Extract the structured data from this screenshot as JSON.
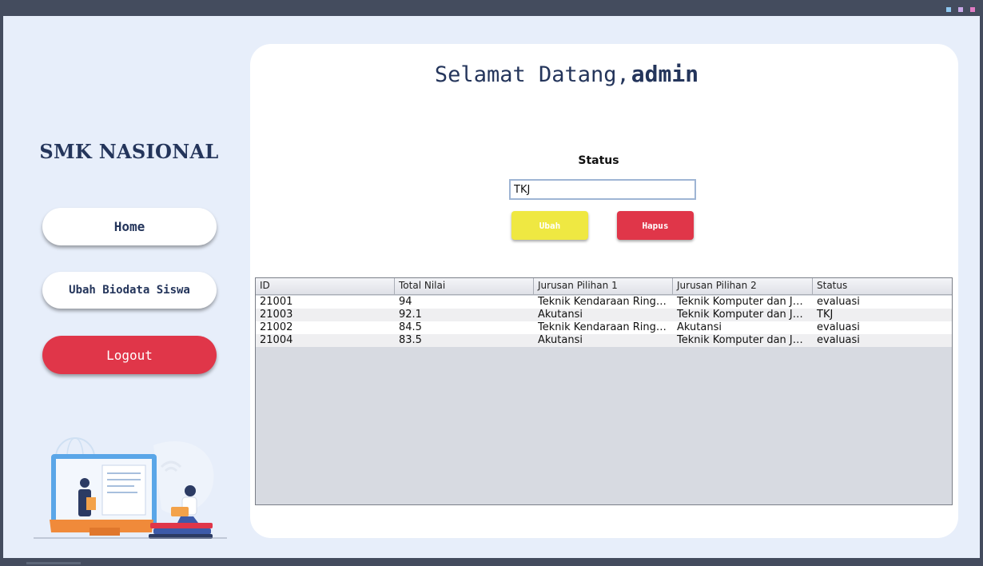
{
  "sidebar": {
    "brand": "SMK NASIONAL",
    "nav": {
      "home": "Home",
      "biodata": "Ubah Biodata Siswa",
      "logout": "Logout"
    }
  },
  "main": {
    "welcome_prefix": "Selamat Datang,",
    "username": "admin",
    "status_label": "Status",
    "status_value": "TKJ",
    "ubah_label": "Ubah",
    "hapus_label": "Hapus"
  },
  "table": {
    "columns": [
      "ID",
      "Total Nilai",
      "Jurusan Pilihan 1",
      "Jurusan Pilihan 2",
      "Status"
    ],
    "rows": [
      [
        "21001",
        "94",
        "Teknik Kendaraan Ringan",
        "Teknik Komputer dan Jar...",
        "evaluasi"
      ],
      [
        "21003",
        "92.1",
        "Akutansi",
        "Teknik Komputer dan Jar...",
        "TKJ"
      ],
      [
        "21002",
        "84.5",
        "Teknik Kendaraan Ringan",
        "Akutansi",
        "evaluasi"
      ],
      [
        "21004",
        "83.5",
        "Akutansi",
        "Teknik Komputer dan Jar...",
        "evaluasi"
      ]
    ]
  },
  "colors": {
    "navy": "#24355b",
    "red": "#e03649",
    "yellow": "#efe842",
    "background": "#e7eefa"
  }
}
